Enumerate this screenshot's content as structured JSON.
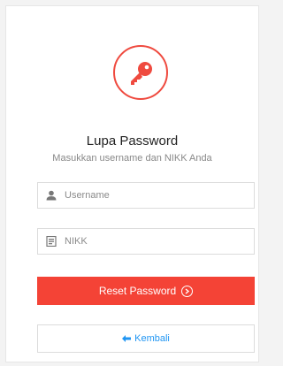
{
  "header": {
    "title": "Lupa Password",
    "subtitle": "Masukkan username dan NIKK Anda",
    "icon": "key-icon"
  },
  "form": {
    "username_placeholder": "Username",
    "nikk_placeholder": "NIKK",
    "reset_label": "Reset Password",
    "back_label": "Kembali"
  },
  "colors": {
    "accent": "#f44336",
    "link": "#2196f3"
  }
}
